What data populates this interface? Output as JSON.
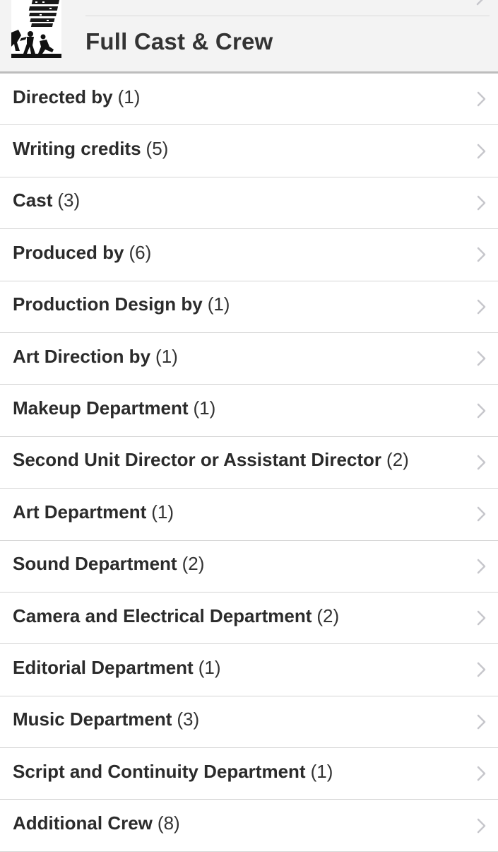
{
  "header": {
    "title": "Full Cast & Crew"
  },
  "credits": [
    {
      "label": "Directed by",
      "count": "(1)"
    },
    {
      "label": "Writing credits",
      "count": "(5)"
    },
    {
      "label": "Cast",
      "count": "(3)"
    },
    {
      "label": "Produced by",
      "count": "(6)"
    },
    {
      "label": "Production Design by",
      "count": "(1)"
    },
    {
      "label": "Art Direction by",
      "count": "(1)"
    },
    {
      "label": "Makeup Department",
      "count": "(1)"
    },
    {
      "label": "Second Unit Director or Assistant Director",
      "count": "(2)"
    },
    {
      "label": "Art Department",
      "count": "(1)"
    },
    {
      "label": "Sound Department",
      "count": "(2)"
    },
    {
      "label": "Camera and Electrical Department",
      "count": "(2)"
    },
    {
      "label": "Editorial Department",
      "count": "(1)"
    },
    {
      "label": "Music Department",
      "count": "(3)"
    },
    {
      "label": "Script and Continuity Department",
      "count": "(1)"
    },
    {
      "label": "Additional Crew",
      "count": "(8)"
    }
  ],
  "icons": {
    "row_chevron": "chevron-right-icon",
    "poster": "movie-poster-thumbnail"
  },
  "colors": {
    "header_bg": "#f3f3f3",
    "header_border": "#bdbdbd",
    "divider": "#d5d5d5",
    "chevron": "#c7c7cc"
  }
}
